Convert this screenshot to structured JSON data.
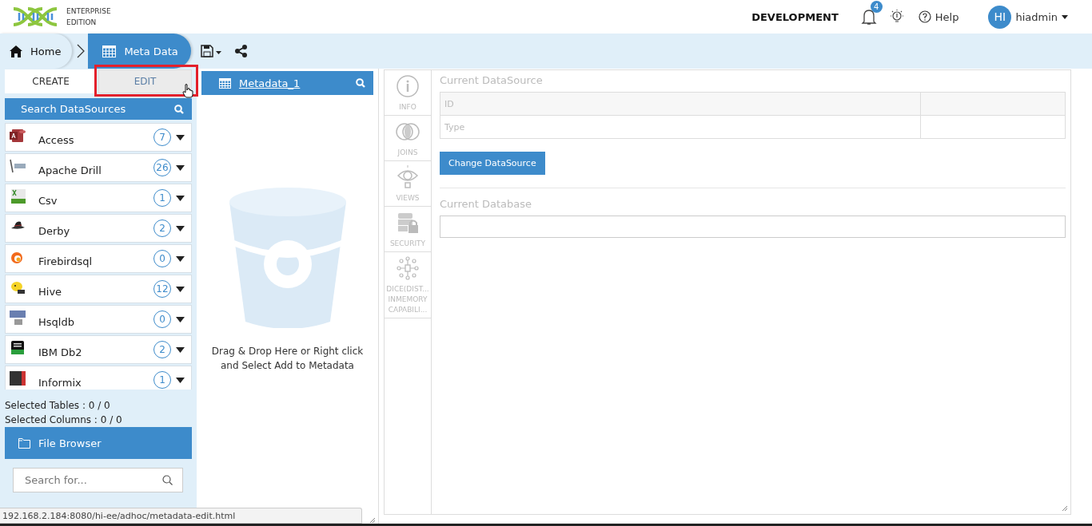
{
  "header": {
    "logo_lines": [
      "ENTERPRISE",
      "EDITION"
    ],
    "environment": "DEVELOPMENT",
    "notification_count": "4",
    "help": "Help",
    "avatar_initials": "HI",
    "username": "hiadmin"
  },
  "breadcrumbs": [
    {
      "label": "Home",
      "kind": "home",
      "selected": false
    },
    {
      "label": "Meta Data",
      "kind": "grid",
      "selected": true
    }
  ],
  "tabs": [
    {
      "label": "CREATE",
      "selected": true,
      "highlighted": false
    },
    {
      "label": "EDIT",
      "selected": false,
      "highlighted": true
    }
  ],
  "datasource_search": {
    "label": "Search DataSources"
  },
  "datasources": [
    {
      "name": "Access",
      "count": "7",
      "kind": "access"
    },
    {
      "name": "Apache Drill",
      "count": "26",
      "kind": "drill"
    },
    {
      "name": "Csv",
      "count": "1",
      "kind": "csv"
    },
    {
      "name": "Derby",
      "count": "2",
      "kind": "derby"
    },
    {
      "name": "Firebirdsql",
      "count": "0",
      "kind": "firebird"
    },
    {
      "name": "Hive",
      "count": "12",
      "kind": "hive"
    },
    {
      "name": "Hsqldb",
      "count": "0",
      "kind": "hsqldb"
    },
    {
      "name": "IBM Db2",
      "count": "2",
      "kind": "db2"
    },
    {
      "name": "Informix",
      "count": "1",
      "kind": "informix"
    }
  ],
  "selection": {
    "tables": "Selected Tables : 0 / 0",
    "columns": "Selected Columns : 0 / 0"
  },
  "file_browser": {
    "label": "File Browser"
  },
  "file_search": {
    "placeholder": "Search for..."
  },
  "metadata": {
    "title": "Metadata_1",
    "drop_hint": "Drag & Drop Here or Right click and Select Add to Metadata"
  },
  "side_tabs": [
    {
      "lines": [
        "INFO"
      ],
      "kind": "info"
    },
    {
      "lines": [
        "JOINS"
      ],
      "kind": "joins"
    },
    {
      "lines": [
        "VIEWS"
      ],
      "kind": "views"
    },
    {
      "lines": [
        "SECURITY"
      ],
      "kind": "security"
    },
    {
      "lines": [
        "DICE(DIST...",
        "INMEMORY",
        "CAPABILI..."
      ],
      "kind": "dice"
    }
  ],
  "datasource": {
    "title": "Current DataSource",
    "rows": [
      {
        "label": "ID"
      },
      {
        "label": "Type"
      }
    ],
    "button": "Change DataSource",
    "database_title": "Current Database"
  },
  "status_url": "192.168.2.184:8080/hi-ee/adhoc/metadata-edit.html"
}
